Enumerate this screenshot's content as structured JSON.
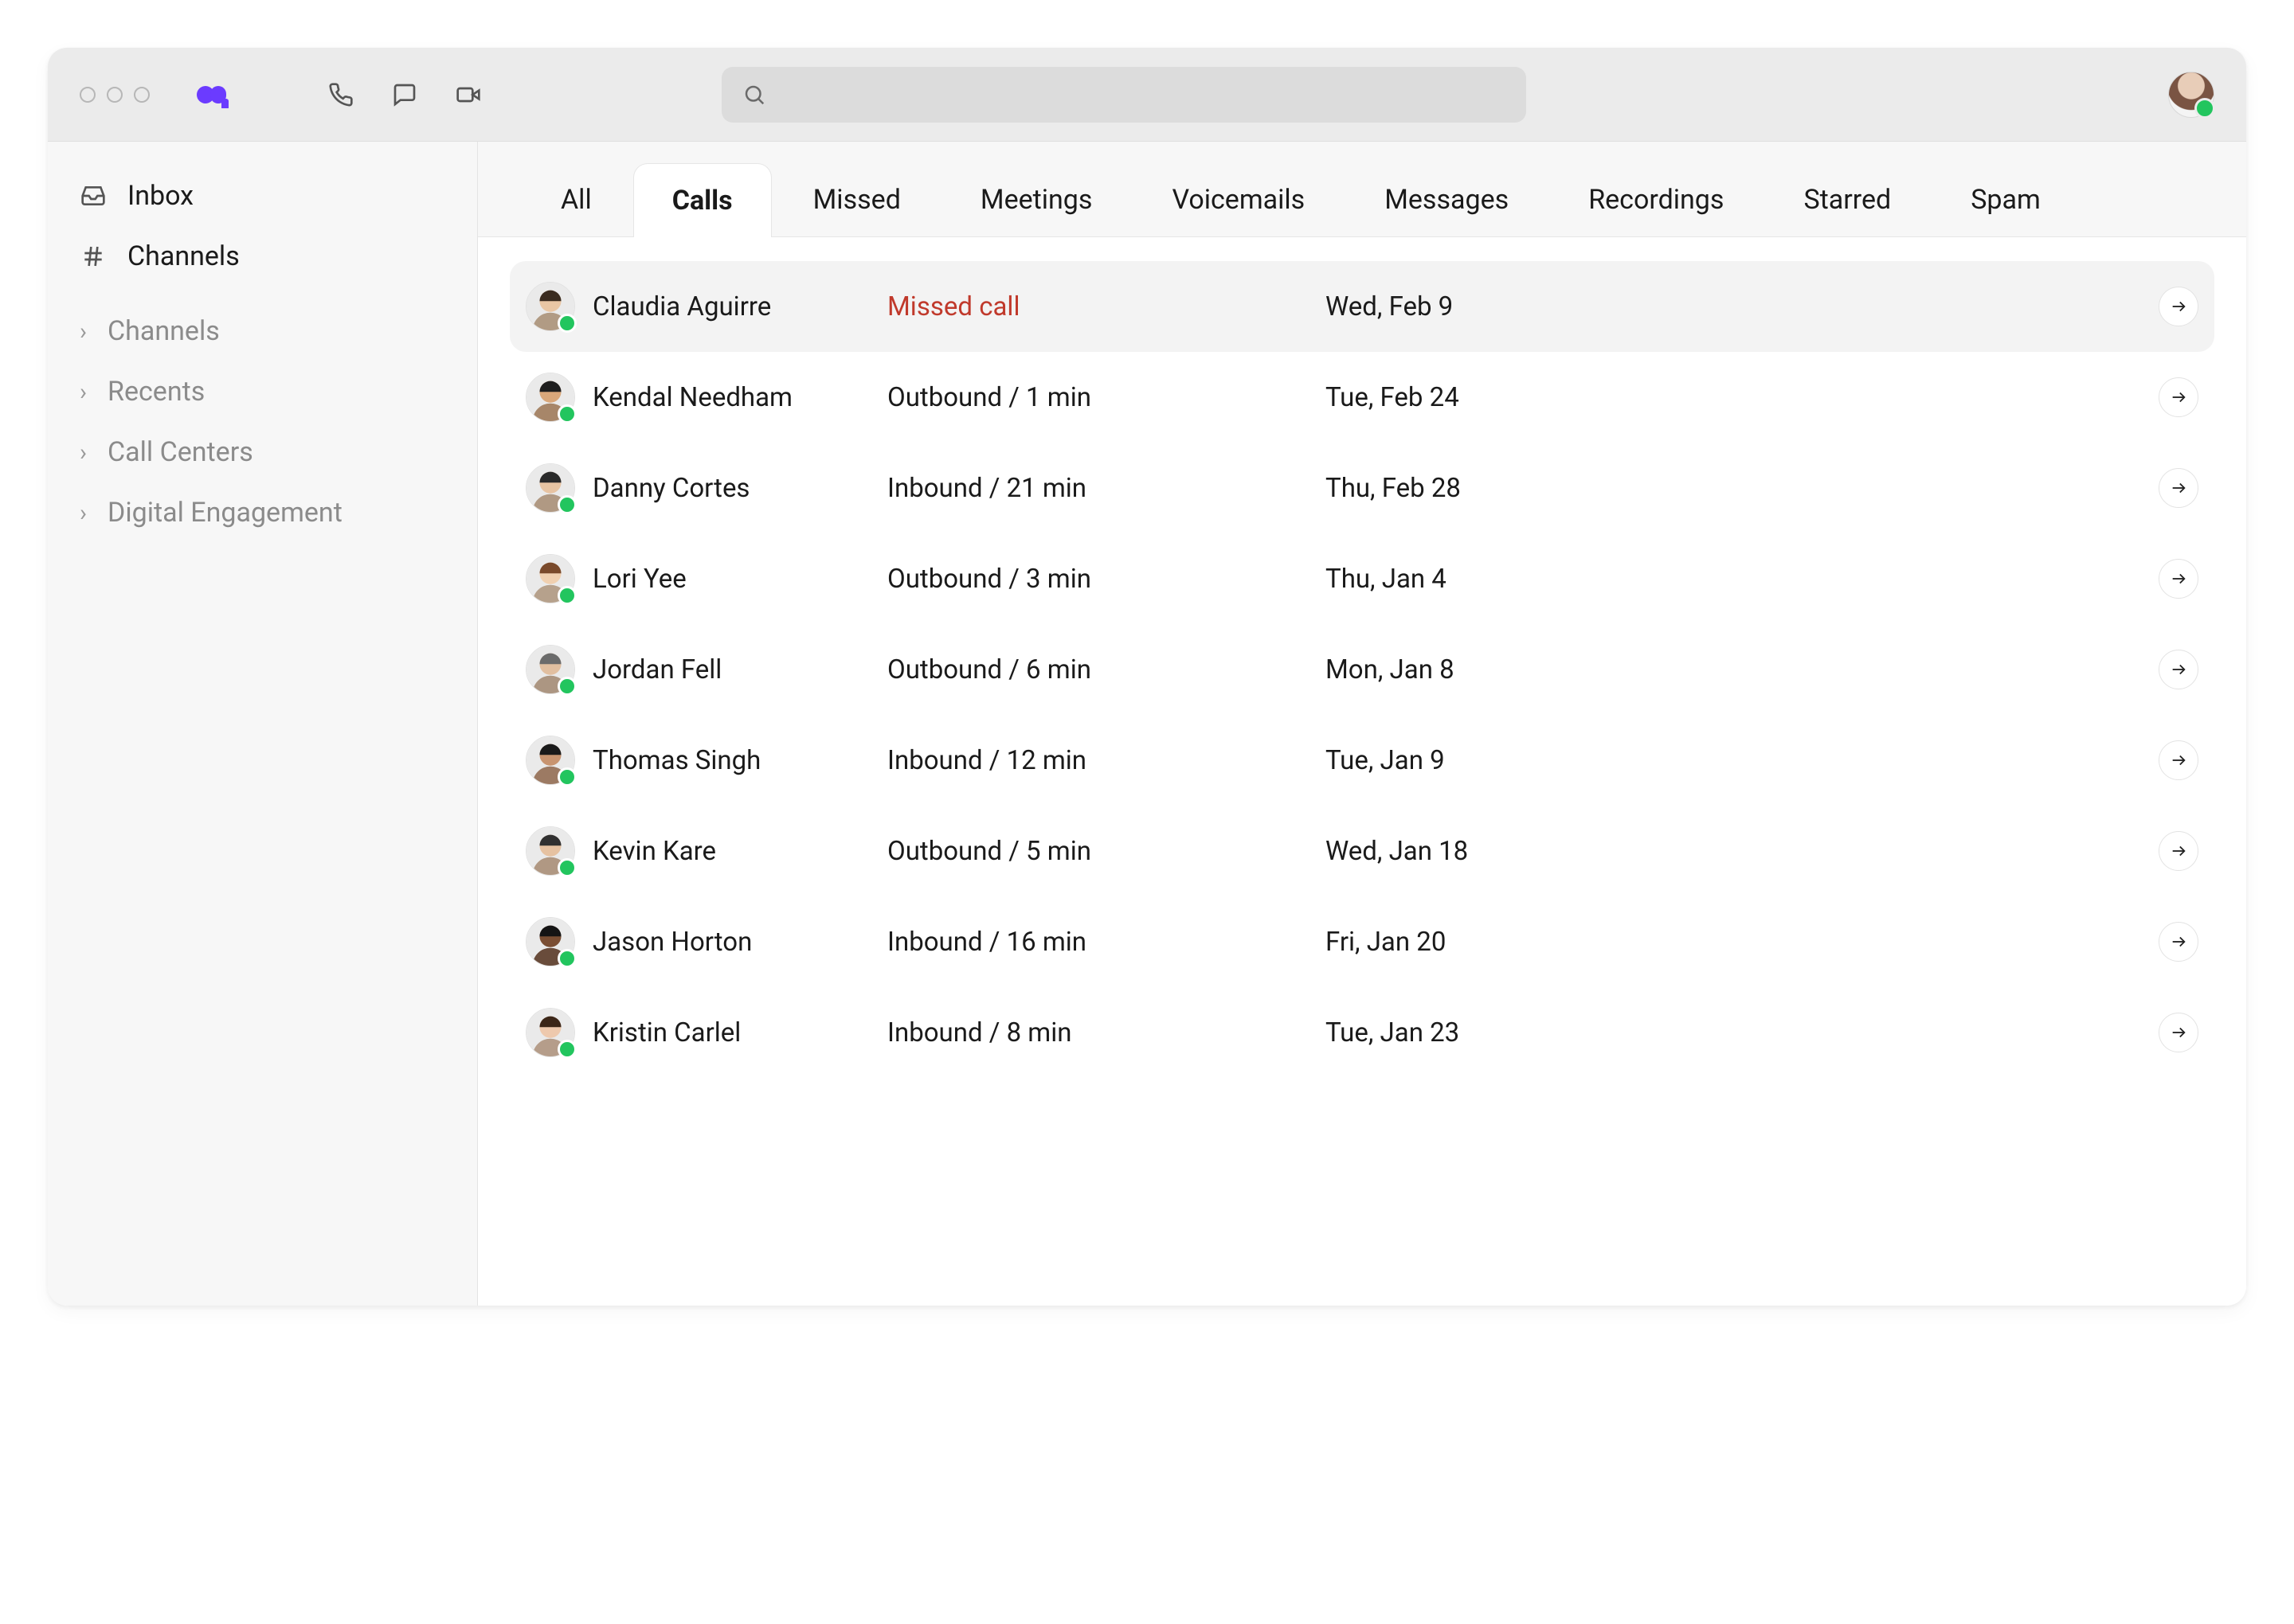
{
  "colors": {
    "accent": "#6b3bff",
    "missed": "#c0392b",
    "presence": "#22c55e"
  },
  "topbar": {
    "icons": [
      "phone-icon",
      "chat-icon",
      "video-icon"
    ],
    "search_placeholder": ""
  },
  "sidebar": {
    "primary": [
      {
        "icon": "inbox-icon",
        "label": "Inbox"
      },
      {
        "icon": "hash-icon",
        "label": "Channels"
      }
    ],
    "secondary": [
      {
        "label": "Channels"
      },
      {
        "label": "Recents"
      },
      {
        "label": "Call Centers"
      },
      {
        "label": "Digital Engagement"
      }
    ]
  },
  "tabs": [
    {
      "label": "All",
      "active": false
    },
    {
      "label": "Calls",
      "active": true
    },
    {
      "label": "Missed",
      "active": false
    },
    {
      "label": "Meetings",
      "active": false
    },
    {
      "label": "Voicemails",
      "active": false
    },
    {
      "label": "Messages",
      "active": false
    },
    {
      "label": "Recordings",
      "active": false
    },
    {
      "label": "Starred",
      "active": false
    },
    {
      "label": "Spam",
      "active": false
    }
  ],
  "calls": [
    {
      "name": "Claudia Aguirre",
      "detail": "Missed call",
      "missed": true,
      "date": "Wed, Feb 9",
      "selected": true,
      "avatar": {
        "skin": "#e9c6a4",
        "hair": "#3a2b1f"
      }
    },
    {
      "name": "Kendal Needham",
      "detail": "Outbound / 1 min",
      "missed": false,
      "date": "Tue, Feb 24",
      "selected": false,
      "avatar": {
        "skin": "#d9a77a",
        "hair": "#1e1e1e"
      }
    },
    {
      "name": "Danny Cortes",
      "detail": "Inbound / 21 min",
      "missed": false,
      "date": "Thu, Feb 28",
      "selected": false,
      "avatar": {
        "skin": "#e7c3a2",
        "hair": "#2a2a2a"
      }
    },
    {
      "name": "Lori Yee",
      "detail": "Outbound / 3 min",
      "missed": false,
      "date": "Thu, Jan 4",
      "selected": false,
      "avatar": {
        "skin": "#f0d0b0",
        "hair": "#7a4a2b"
      }
    },
    {
      "name": "Jordan Fell",
      "detail": "Outbound / 6 min",
      "missed": false,
      "date": "Mon, Jan 8",
      "selected": false,
      "avatar": {
        "skin": "#e1bfa0",
        "hair": "#6b6b6b"
      }
    },
    {
      "name": "Thomas Singh",
      "detail": "Inbound / 12 min",
      "missed": false,
      "date": "Tue, Jan 9",
      "selected": false,
      "avatar": {
        "skin": "#c89470",
        "hair": "#1a1a1a"
      }
    },
    {
      "name": "Kevin Kare",
      "detail": "Outbound / 5 min",
      "missed": false,
      "date": "Wed, Jan 18",
      "selected": false,
      "avatar": {
        "skin": "#e6c2a1",
        "hair": "#303030"
      }
    },
    {
      "name": "Jason Horton",
      "detail": "Inbound / 16 min",
      "missed": false,
      "date": "Fri, Jan 20",
      "selected": false,
      "avatar": {
        "skin": "#7a4e33",
        "hair": "#141414"
      }
    },
    {
      "name": "Kristin Carlel",
      "detail": "Inbound / 8 min",
      "missed": false,
      "date": "Tue, Jan 23",
      "selected": false,
      "avatar": {
        "skin": "#eec9ad",
        "hair": "#3b2618"
      }
    }
  ]
}
